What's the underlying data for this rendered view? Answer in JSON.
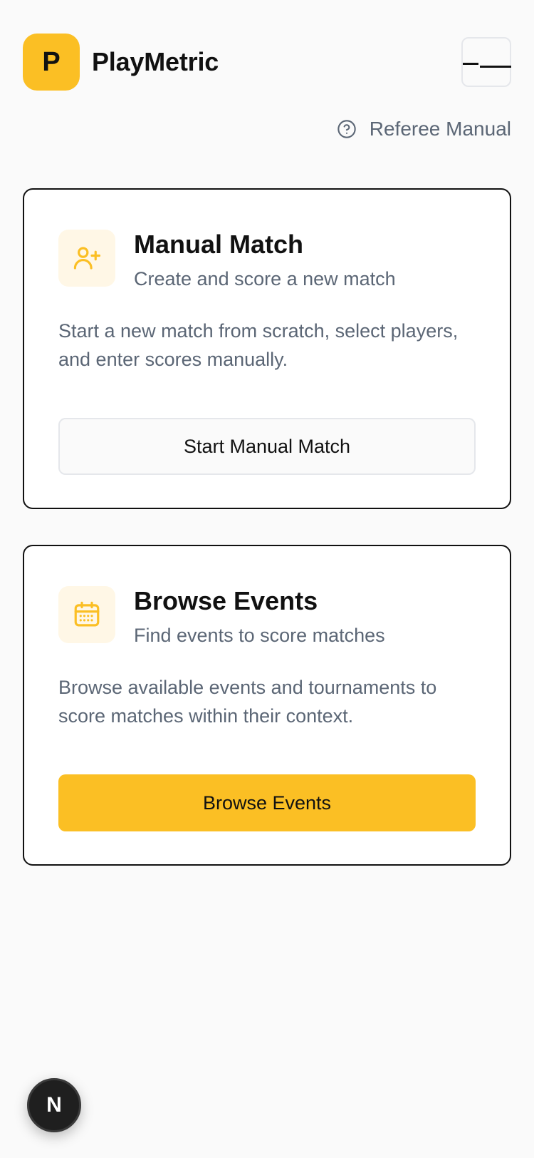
{
  "header": {
    "logo_letter": "P",
    "brand_name": "PlayMetric"
  },
  "manual_link": {
    "label": "Referee Manual",
    "icon": "help-circle-icon"
  },
  "cards": [
    {
      "title": "Manual Match",
      "subtitle": "Create and score a new match",
      "description": "Start a new match from scratch, select players, and enter scores manually.",
      "button_label": "Start Manual Match",
      "icon": "user-plus-icon"
    },
    {
      "title": "Browse Events",
      "subtitle": "Find events to score matches",
      "description": "Browse available events and tournaments to score matches within their context.",
      "button_label": "Browse Events",
      "icon": "calendar-icon"
    }
  ],
  "dev_badge": {
    "letter": "N"
  },
  "colors": {
    "accent": "#fbbf24",
    "accent_soft": "#fff7e6",
    "text_primary": "#111111",
    "text_muted": "#5b6675",
    "border": "#e5e7eb"
  }
}
